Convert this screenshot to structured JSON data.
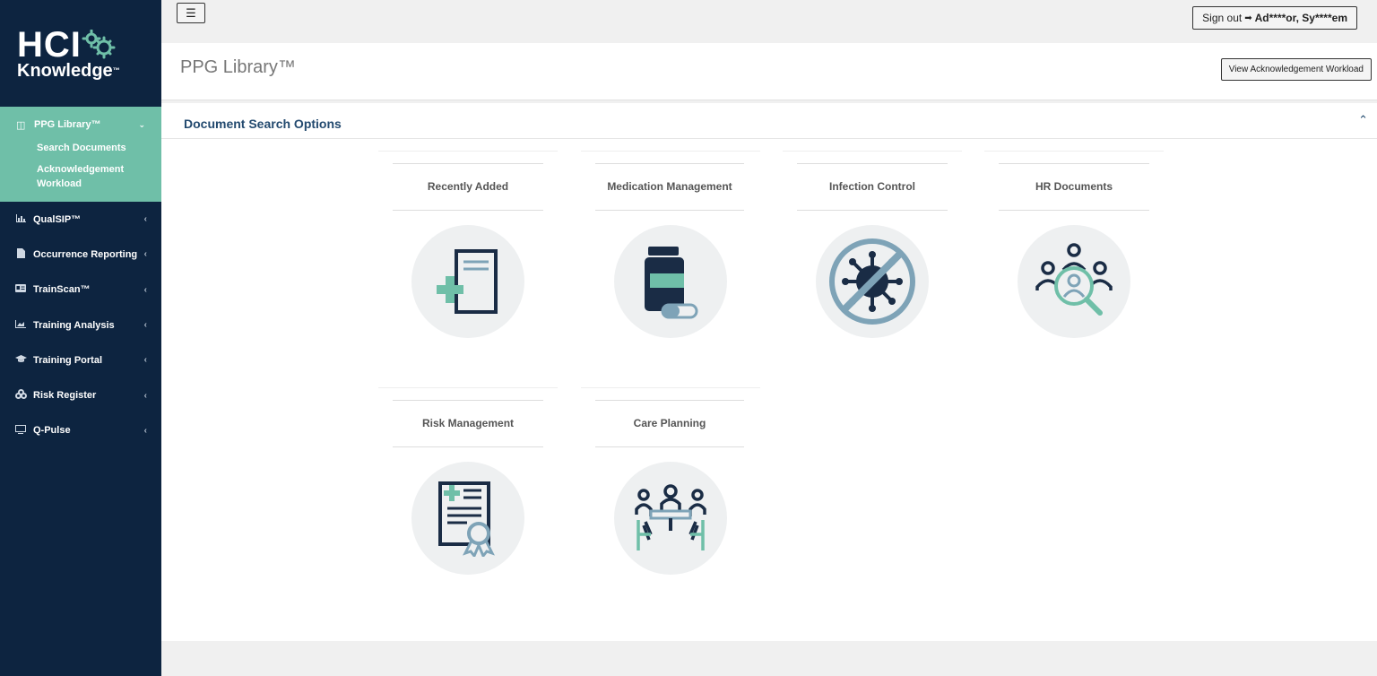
{
  "logo": {
    "line1": "HCI",
    "line2": "Knowledge",
    "tm": "™"
  },
  "sidebar": {
    "active": {
      "label": "PPG Library™",
      "icon": "library-icon",
      "sub": [
        "Search Documents",
        "Acknowledgement Workload"
      ]
    },
    "items": [
      {
        "label": "QualSIP™",
        "icon": "bar-chart-icon"
      },
      {
        "label": "Occurrence Reporting",
        "icon": "file-icon"
      },
      {
        "label": "TrainScan™",
        "icon": "id-card-icon"
      },
      {
        "label": "Training Analysis",
        "icon": "area-chart-icon"
      },
      {
        "label": "Training Portal",
        "icon": "graduation-cap-icon"
      },
      {
        "label": "Risk Register",
        "icon": "biohazard-icon"
      },
      {
        "label": "Q-Pulse",
        "icon": "monitor-icon"
      }
    ]
  },
  "topbar": {
    "signout_label": "Sign out",
    "user": "Ad****or, Sy****em"
  },
  "header": {
    "title": "PPG Library™",
    "ack_button": "View Acknowledgement Workload"
  },
  "section": {
    "title": "Document Search Options"
  },
  "cards": [
    {
      "title": "Recently Added",
      "icon": "document-plus-icon"
    },
    {
      "title": "Medication Management",
      "icon": "medicine-bottle-icon"
    },
    {
      "title": "Infection Control",
      "icon": "no-virus-icon"
    },
    {
      "title": "HR Documents",
      "icon": "people-search-icon"
    },
    {
      "title": "Risk Management",
      "icon": "certificate-icon"
    },
    {
      "title": "Care Planning",
      "icon": "meeting-table-icon"
    }
  ],
  "colors": {
    "sidebar": "#0d2440",
    "accent": "#6fbfa8",
    "navy": "#1a2c45",
    "teal": "#6fbfa8",
    "steel": "#7ea3b7"
  }
}
